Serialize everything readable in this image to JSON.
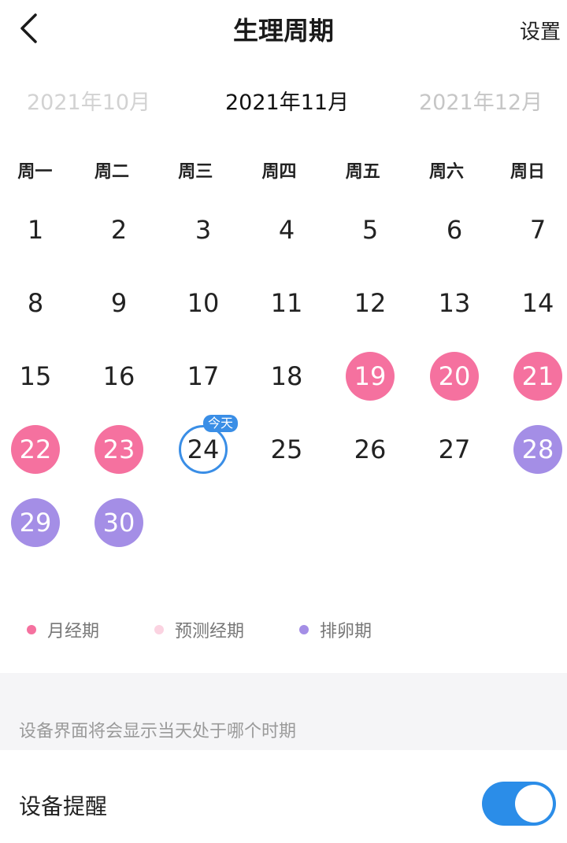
{
  "header": {
    "title": "生理周期",
    "settings_label": "设置"
  },
  "months": {
    "prev": "2021年10月",
    "current": "2021年11月",
    "next": "2021年12月"
  },
  "weekdays": [
    "周一",
    "周二",
    "周三",
    "周四",
    "周五",
    "周六",
    "周日"
  ],
  "days": [
    {
      "label": "1",
      "type": "normal"
    },
    {
      "label": "2",
      "type": "normal"
    },
    {
      "label": "3",
      "type": "normal"
    },
    {
      "label": "4",
      "type": "normal"
    },
    {
      "label": "5",
      "type": "normal"
    },
    {
      "label": "6",
      "type": "normal"
    },
    {
      "label": "7",
      "type": "normal"
    },
    {
      "label": "8",
      "type": "normal"
    },
    {
      "label": "9",
      "type": "normal"
    },
    {
      "label": "10",
      "type": "normal"
    },
    {
      "label": "11",
      "type": "normal"
    },
    {
      "label": "12",
      "type": "normal"
    },
    {
      "label": "13",
      "type": "normal"
    },
    {
      "label": "14",
      "type": "normal"
    },
    {
      "label": "15",
      "type": "normal"
    },
    {
      "label": "16",
      "type": "normal"
    },
    {
      "label": "17",
      "type": "normal"
    },
    {
      "label": "18",
      "type": "normal"
    },
    {
      "label": "19",
      "type": "period"
    },
    {
      "label": "20",
      "type": "period"
    },
    {
      "label": "21",
      "type": "period"
    },
    {
      "label": "22",
      "type": "period"
    },
    {
      "label": "23",
      "type": "period"
    },
    {
      "label": "24",
      "type": "today"
    },
    {
      "label": "25",
      "type": "normal"
    },
    {
      "label": "26",
      "type": "normal"
    },
    {
      "label": "27",
      "type": "normal"
    },
    {
      "label": "28",
      "type": "ovulation"
    },
    {
      "label": "29",
      "type": "ovulation"
    },
    {
      "label": "30",
      "type": "ovulation"
    }
  ],
  "today_badge": "今天",
  "legend": {
    "period": "月经期",
    "predicted": "预测经期",
    "ovulation": "排卵期"
  },
  "colors": {
    "period": "#f5719f",
    "predicted": "#fbd3e1",
    "ovulation": "#a48ee6",
    "accent": "#2b8de8"
  },
  "info_text": "设备界面将会显示当天处于哪个时期",
  "reminder": {
    "label": "设备提醒",
    "enabled": true
  }
}
